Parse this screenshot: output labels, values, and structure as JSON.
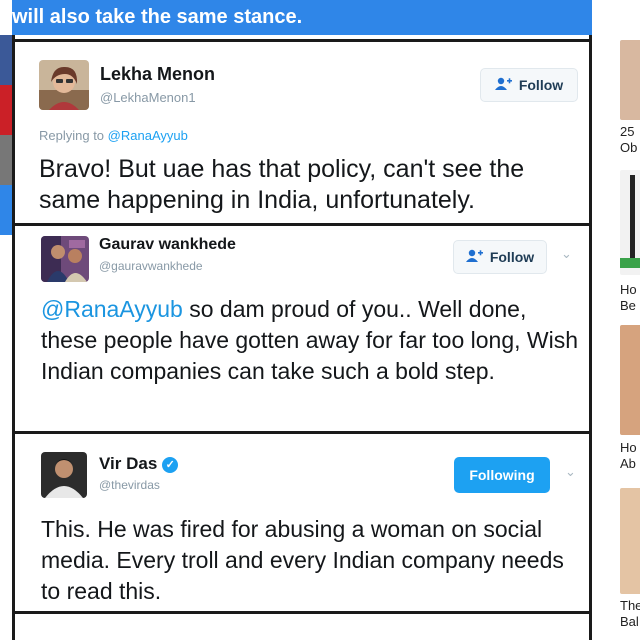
{
  "headline": "will also take the same stance.",
  "tweets": [
    {
      "name": "Lekha Menon",
      "handle": "@LekhaMenon1",
      "button": "Follow",
      "reply_prefix": "Replying to",
      "reply_mention": "@RanaAyyub",
      "text": "Bravo! But uae has that policy, can't see the same happening in India, unfortunately."
    },
    {
      "name": "Gaurav wankhede",
      "handle": "@gauravwankhede",
      "button": "Follow",
      "mention": "@RanaAyyub",
      "text": " so dam proud of you.. Well done, these people have gotten away for far too long, Wish Indian companies can take such a bold step."
    },
    {
      "name": "Vir Das",
      "handle": "@thevirdas",
      "verified": true,
      "button": "Following",
      "text": "This. He was fired for abusing a woman on social media. Every troll and every Indian company needs to read this."
    }
  ],
  "sidebar_ads": [
    {
      "line1": "25",
      "line2": "Ob"
    },
    {
      "line1": "Ho",
      "line2": "Be"
    },
    {
      "line1": "Ho",
      "line2": "Ab"
    },
    {
      "line1": "The",
      "line2": "Bal"
    }
  ],
  "colors": {
    "headline_bg": "#2f86e8",
    "twitter_blue": "#1da1f2",
    "share_colors": [
      "#3b5998",
      "#cb2027",
      "#777777",
      "#2f86e8"
    ]
  },
  "icons": [
    "add-user-icon",
    "chevron-down-icon",
    "verified-badge-icon"
  ]
}
